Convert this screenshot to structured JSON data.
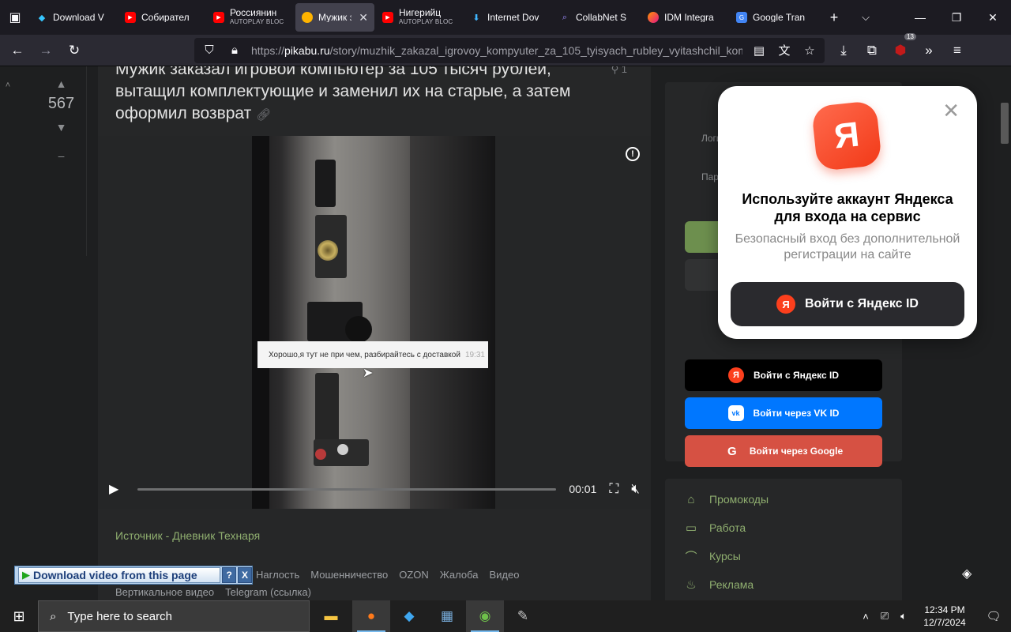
{
  "browser": {
    "tabs": [
      {
        "title": "Download V",
        "sub": "",
        "icon": "downloader-icon",
        "active": false
      },
      {
        "title": "Собирател",
        "sub": "",
        "icon": "youtube-icon",
        "active": false
      },
      {
        "title": "Россиянин",
        "sub": "AUTOPLAY BLOC",
        "icon": "youtube-icon",
        "active": false
      },
      {
        "title": "Мужик з",
        "sub": "",
        "icon": "pikabu-icon",
        "active": true
      },
      {
        "title": "Нигерийц",
        "sub": "AUTOPLAY BLOC",
        "icon": "youtube-icon",
        "active": false
      },
      {
        "title": "Internet Dov",
        "sub": "",
        "icon": "idm-icon",
        "active": false
      },
      {
        "title": "CollabNet S",
        "sub": "",
        "icon": "collabnet-icon",
        "active": false
      },
      {
        "title": "IDM Integra",
        "sub": "",
        "icon": "firefox-icon",
        "active": false
      },
      {
        "title": "Google Tran",
        "sub": "",
        "icon": "google-translate-icon",
        "active": false
      }
    ],
    "url_prefix": "https://",
    "url_domain": "pikabu.ru",
    "url_path": "/story/muzhik_zakazal_igrovoy_kompyuter_za_105_tyisyach_rubley_vyitashchil_komplektuyushchie_",
    "extensions_badge": "13"
  },
  "story": {
    "rating": "567",
    "title": "Мужик заказал игровой компьютер за 105 тысяч рублей, вытащил комплектующие и заменил их на старые, а затем оформил возврат",
    "video_caption": "Хорошо,я тут не при чем, разбирайтесь с доставкой",
    "video_caption_time": "19:31",
    "video_time": "00:01",
    "video_progress": 0.0,
    "source": "Источник - Дневник Технаря",
    "tags_row1": [
      "Наглость",
      "Мошенничество",
      "OZON",
      "Жалоба",
      "Видео"
    ],
    "tags_row2": [
      "Вертикальное видео",
      "Telegram (ссылка)"
    ]
  },
  "sidebar": {
    "login_placeholder": "Логин",
    "password_placeholder": "Пароль",
    "yandex_btn": "Войти с Яндекс ID",
    "vk_btn": "Войти через VK ID",
    "google_btn": "Войти через Google",
    "menu": [
      {
        "label": "Промокоды",
        "icon": "tag-icon"
      },
      {
        "label": "Работа",
        "icon": "briefcase-icon"
      },
      {
        "label": "Курсы",
        "icon": "graduation-cap-icon"
      },
      {
        "label": "Реклама",
        "icon": "flame-icon"
      }
    ]
  },
  "yandex_popup": {
    "title": "Используйте аккаунт Яндекса для входа на сервис",
    "subtitle": "Безопасный вход без дополнительной регистрации на сайте",
    "button": "Войти с Яндекс ID",
    "logo_letter": "Я"
  },
  "idm": {
    "label": "Download video from this page",
    "help": "?",
    "close": "X"
  },
  "taskbar": {
    "search_placeholder": "Type here to search",
    "time": "12:34 PM",
    "date": "12/7/2024"
  },
  "colors": {
    "accent_green": "#8fae6f",
    "yandex_red": "#fc3f1d",
    "vk_blue": "#0077ff",
    "google_red": "#d65143"
  }
}
